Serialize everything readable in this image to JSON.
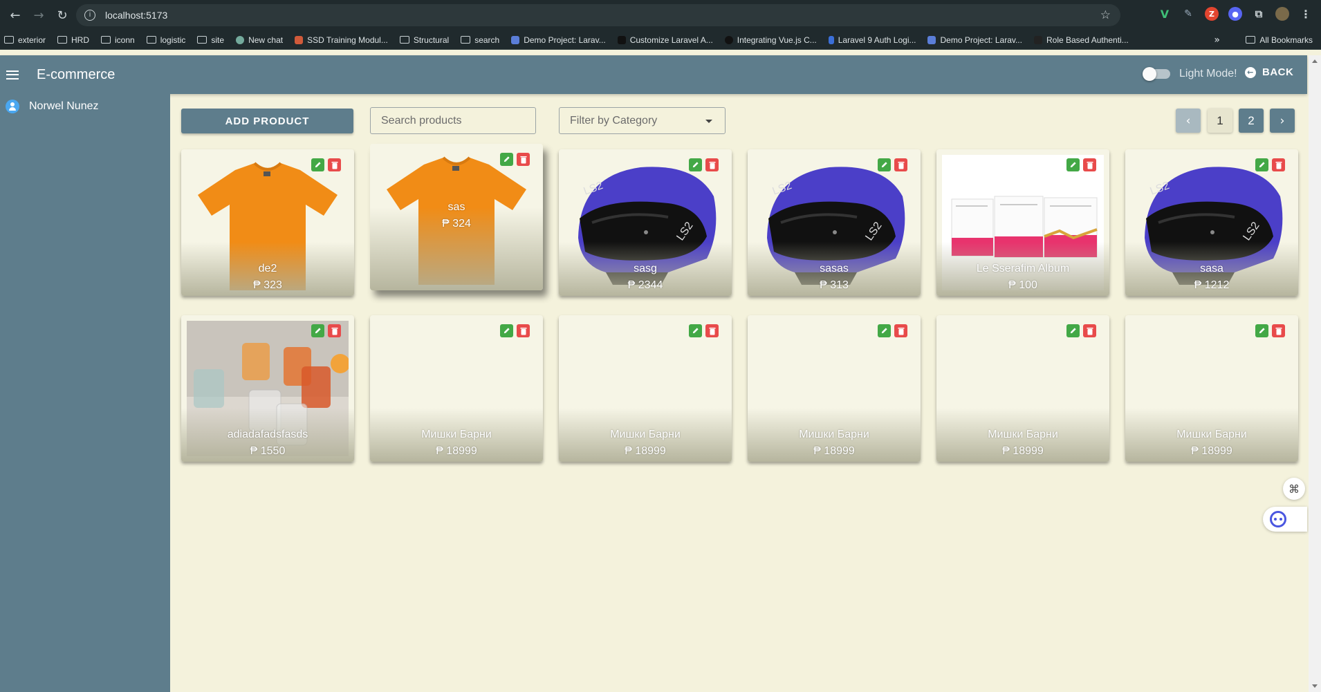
{
  "browser": {
    "url": "localhost:5173",
    "bookmarks": [
      "exterior",
      "HRD",
      "iconn",
      "logistic",
      "site",
      "New chat",
      "SSD Training Modul...",
      "Structural",
      "search",
      "Demo Project: Larav...",
      "Customize Laravel A...",
      "Integrating Vue.js C...",
      "Laravel 9 Auth Logi...",
      "Demo Project: Larav...",
      "Role Based Authenti..."
    ],
    "more": "»",
    "all_bookmarks": "All Bookmarks"
  },
  "header": {
    "title": "E-commerce",
    "toggle_label": "Light Mode!",
    "back_label": "BACK"
  },
  "sidebar": {
    "user_name": "Norwel Nunez"
  },
  "toolbar": {
    "add_label": "ADD PRODUCT",
    "search_placeholder": "Search products",
    "filter_placeholder": "Filter by Category",
    "pages": [
      "1",
      "2"
    ],
    "current_page": "1"
  },
  "products": [
    {
      "name": "de2",
      "price": "₱ 323",
      "image": "orange-tshirt"
    },
    {
      "name": "sas",
      "price": "₱ 324",
      "image": "orange-tshirt"
    },
    {
      "name": "sasg",
      "price": "₱ 2344",
      "image": "blue-helmet"
    },
    {
      "name": "sasas",
      "price": "₱ 313",
      "image": "blue-helmet"
    },
    {
      "name": "Le Sserafim Album",
      "price": "₱ 100",
      "image": "album-boxes"
    },
    {
      "name": "sasa",
      "price": "₱ 1212",
      "image": "blue-helmet"
    },
    {
      "name": "adiadafadsfasds",
      "price": "₱ 1550",
      "image": "drink-glasses"
    },
    {
      "name": "Мишки Барни",
      "price": "₱ 18999",
      "image": ""
    },
    {
      "name": "Мишки Барни",
      "price": "₱ 18999",
      "image": ""
    },
    {
      "name": "Мишки Барни",
      "price": "₱ 18999",
      "image": ""
    },
    {
      "name": "Мишки Барни",
      "price": "₱ 18999",
      "image": ""
    },
    {
      "name": "Мишки Барни",
      "price": "₱ 18999",
      "image": ""
    }
  ],
  "colors": {
    "primary": "#5e7d8c",
    "background": "#f4f2dc",
    "edit": "#43a846",
    "delete": "#e84b4b"
  }
}
